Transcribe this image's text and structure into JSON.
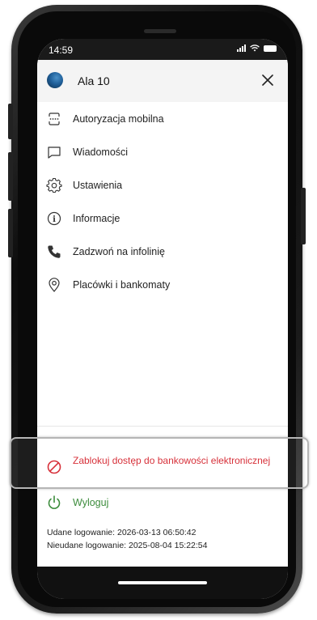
{
  "status_bar": {
    "time": "14:59",
    "signal_icon": "signal-icon",
    "wifi_icon": "wifi-icon",
    "battery_icon": "battery-icon"
  },
  "header": {
    "user_name": "Ala 10",
    "avatar_icon": "avatar-icon",
    "close_icon": "close-icon"
  },
  "menu": {
    "items": [
      {
        "label": "Autoryzacja mobilna",
        "icon": "mobile-authorization-icon"
      },
      {
        "label": "Wiadomości",
        "icon": "message-icon"
      },
      {
        "label": "Ustawienia",
        "icon": "gear-icon"
      },
      {
        "label": "Informacje",
        "icon": "info-icon"
      },
      {
        "label": "Zadzwoń na infolinię",
        "icon": "phone-icon"
      },
      {
        "label": "Placówki i bankomaty",
        "icon": "location-pin-icon"
      }
    ]
  },
  "actions": {
    "block_label": "Zablokuj dostęp do bankowości elektronicznej",
    "logout_label": "Wyloguj"
  },
  "login_info": {
    "successful": "Udane logowanie: 2026-03-13 06:50:42",
    "failed": "Nieudane logowanie: 2025-08-04 15:22:54"
  },
  "colors": {
    "danger": "#d4202a",
    "success": "#3c8c3c",
    "header_bg": "#f4f4f4",
    "status_bg": "#1a1a1a"
  }
}
